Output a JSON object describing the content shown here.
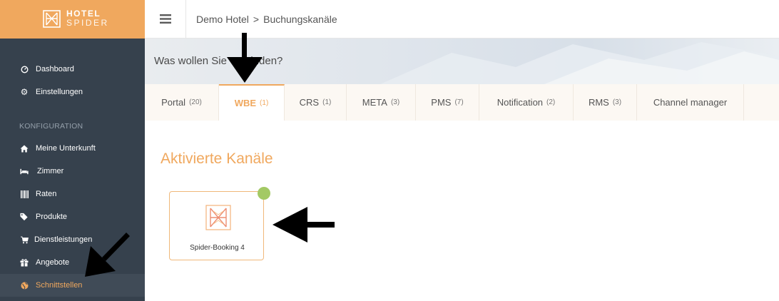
{
  "brand": {
    "line1": "HOTEL",
    "line2": "SPIDER",
    "color": "#f0a85e"
  },
  "sidebar": {
    "items_top": [
      {
        "label": "Dashboard",
        "icon": "gauge-icon"
      },
      {
        "label": "Einstellungen",
        "icon": "gear-icon"
      }
    ],
    "section": "KONFIGURATION",
    "items": [
      {
        "label": "Meine Unterkunft",
        "icon": "home-icon"
      },
      {
        "label": "Zimmer",
        "icon": "bed-icon"
      },
      {
        "label": "Raten",
        "icon": "barcode-icon"
      },
      {
        "label": "Produkte",
        "icon": "tags-icon"
      },
      {
        "label": "Dienstleistungen",
        "icon": "cart-icon"
      },
      {
        "label": "Angebote",
        "icon": "gift-icon"
      },
      {
        "label": "Schnittstellen",
        "icon": "globe-icon",
        "active": true
      }
    ]
  },
  "header": {
    "breadcrumb": [
      "Demo Hotel",
      "Buchungskanäle"
    ],
    "separator": ">"
  },
  "hero": {
    "title": "Was wollen Sie verbinden?"
  },
  "tabs": [
    {
      "label": "Portal",
      "count": "(20)"
    },
    {
      "label": "WBE",
      "count": "(1)",
      "active": true
    },
    {
      "label": "CRS",
      "count": "(1)"
    },
    {
      "label": "META",
      "count": "(3)"
    },
    {
      "label": "PMS",
      "count": "(7)"
    },
    {
      "label": "Notification",
      "count": "(2)"
    },
    {
      "label": "RMS",
      "count": "(3)"
    },
    {
      "label": "Channel manager",
      "count": ""
    }
  ],
  "main": {
    "section_title": "Aktivierte Kanäle",
    "channels": [
      {
        "name": "Spider-Booking 4",
        "status": "active",
        "status_color": "#a3c964"
      }
    ]
  }
}
